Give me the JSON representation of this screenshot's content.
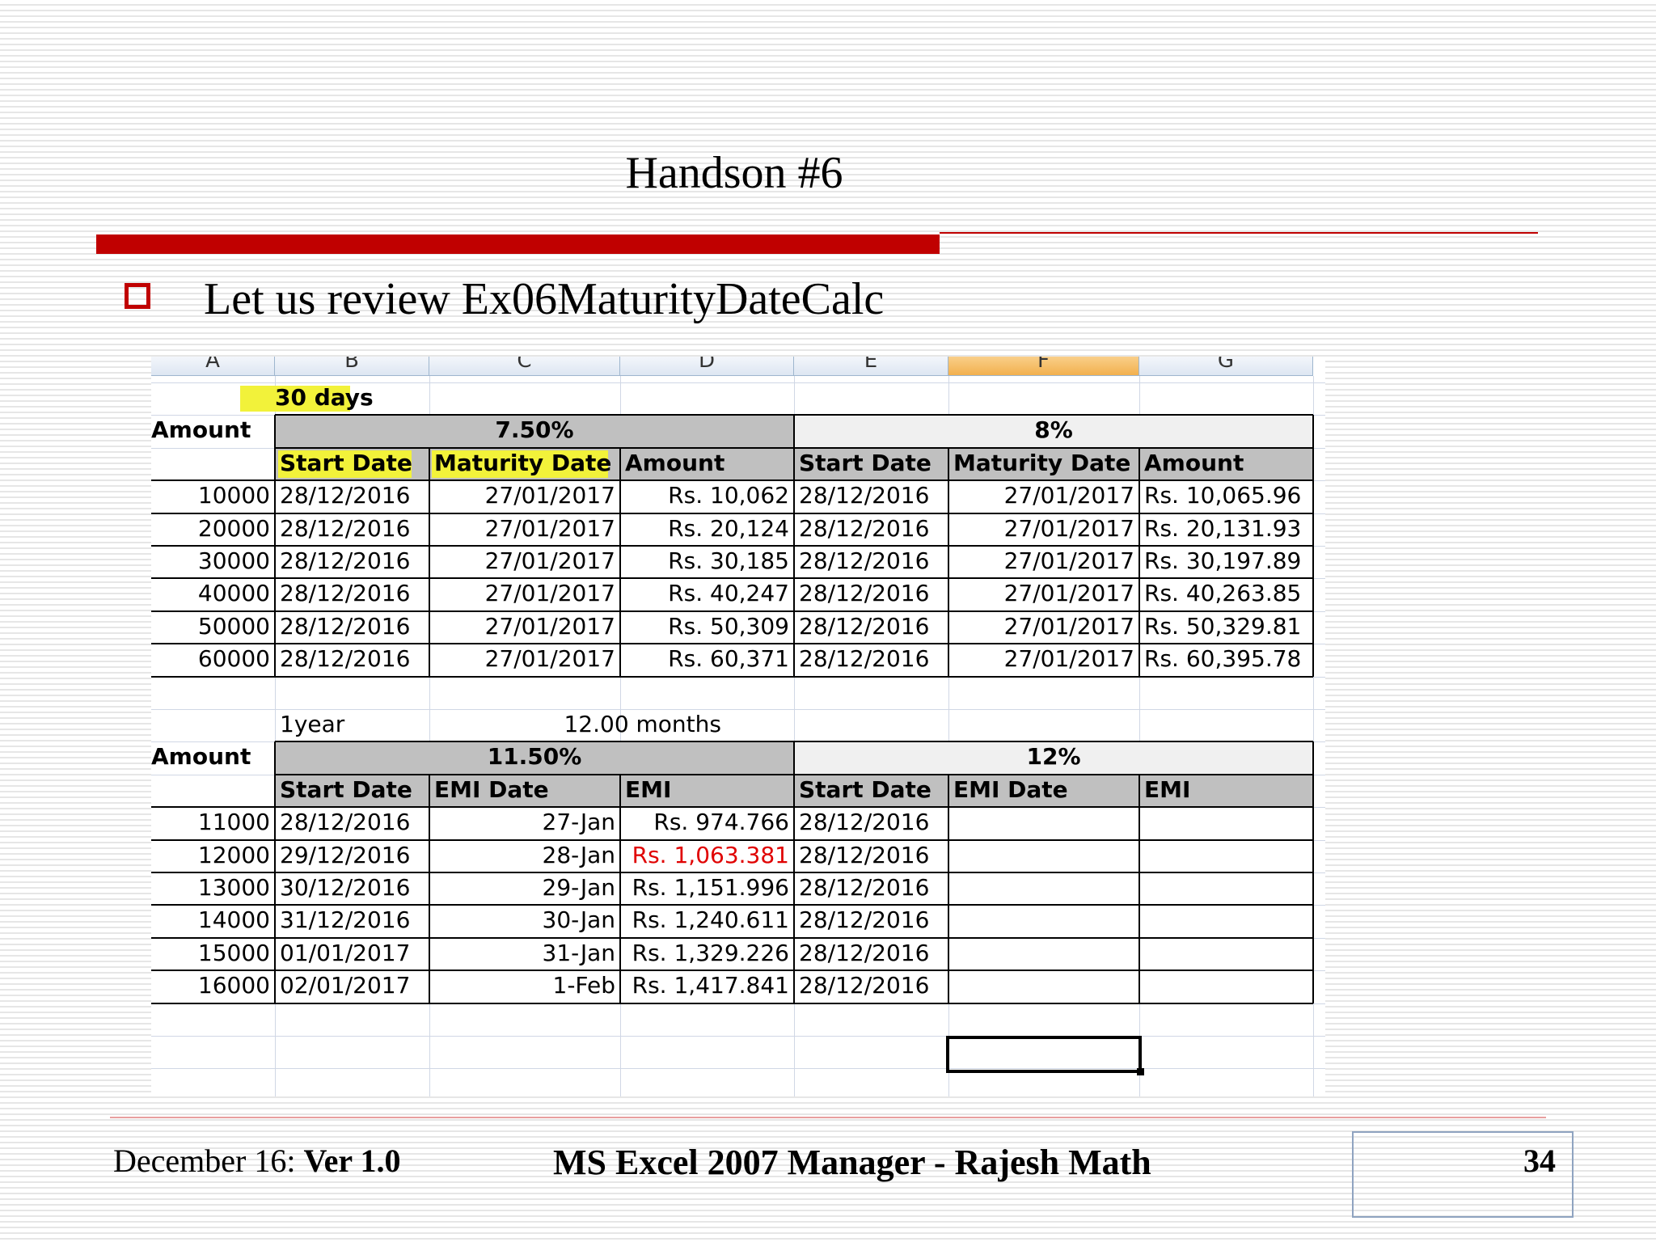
{
  "slide": {
    "title": "Handson #6",
    "bullet": "Let us review Ex06MaturityDateCalc"
  },
  "sheet": {
    "column_headers": [
      "A",
      "B",
      "C",
      "D",
      "E",
      "F",
      "G"
    ],
    "selected_column": "F",
    "table1": {
      "period_label": "30 days",
      "amount_header": "Amount",
      "rate_a": "7.50%",
      "rate_b": "8%",
      "sub_headers_a": [
        "Start Date",
        "Maturity Date",
        "Amount"
      ],
      "sub_headers_b": [
        "Start Date",
        "Maturity Date",
        "Amount"
      ],
      "rows": [
        [
          "10000",
          "28/12/2016",
          "27/01/2017",
          "Rs. 10,062",
          "28/12/2016",
          "27/01/2017",
          "Rs. 10,065.96"
        ],
        [
          "20000",
          "28/12/2016",
          "27/01/2017",
          "Rs. 20,124",
          "28/12/2016",
          "27/01/2017",
          "Rs. 20,131.93"
        ],
        [
          "30000",
          "28/12/2016",
          "27/01/2017",
          "Rs. 30,185",
          "28/12/2016",
          "27/01/2017",
          "Rs. 30,197.89"
        ],
        [
          "40000",
          "28/12/2016",
          "27/01/2017",
          "Rs. 40,247",
          "28/12/2016",
          "27/01/2017",
          "Rs. 40,263.85"
        ],
        [
          "50000",
          "28/12/2016",
          "27/01/2017",
          "Rs. 50,309",
          "28/12/2016",
          "27/01/2017",
          "Rs. 50,329.81"
        ],
        [
          "60000",
          "28/12/2016",
          "27/01/2017",
          "Rs. 60,371",
          "28/12/2016",
          "27/01/2017",
          "Rs. 60,395.78"
        ]
      ]
    },
    "table2": {
      "year_label": "1year",
      "months_label": "12.00 months",
      "amount_header": "Amount",
      "rate_a": "11.50%",
      "rate_b": "12%",
      "sub_headers_a": [
        "Start Date",
        "EMI Date",
        "EMI"
      ],
      "sub_headers_b": [
        "Start Date",
        "EMI Date",
        "EMI"
      ],
      "rows": [
        [
          "11000",
          "28/12/2016",
          "27-Jan",
          "Rs. 974.766",
          "28/12/2016",
          "",
          ""
        ],
        [
          "12000",
          "29/12/2016",
          "28-Jan",
          "Rs. 1,063.381",
          "28/12/2016",
          "",
          ""
        ],
        [
          "13000",
          "30/12/2016",
          "29-Jan",
          "Rs. 1,151.996",
          "28/12/2016",
          "",
          ""
        ],
        [
          "14000",
          "31/12/2016",
          "30-Jan",
          "Rs. 1,240.611",
          "28/12/2016",
          "",
          ""
        ],
        [
          "15000",
          "01/01/2017",
          "31-Jan",
          "Rs. 1,329.226",
          "28/12/2016",
          "",
          ""
        ],
        [
          "16000",
          "02/01/2017",
          "1-Feb",
          "Rs. 1,417.841",
          "28/12/2016",
          "",
          ""
        ]
      ],
      "highlight_red_cell": "Rs. 1,063.381"
    }
  },
  "footer": {
    "date_label": "December 16: ",
    "version": "Ver 1.0",
    "center": "MS Excel 2007 Manager - Rajesh Math",
    "page_number": "34"
  },
  "colors": {
    "accent_red": "#c00000",
    "header_gray": "#c0c0c0",
    "highlight_yellow": "#f2f23a",
    "negative_red": "#e00000"
  }
}
